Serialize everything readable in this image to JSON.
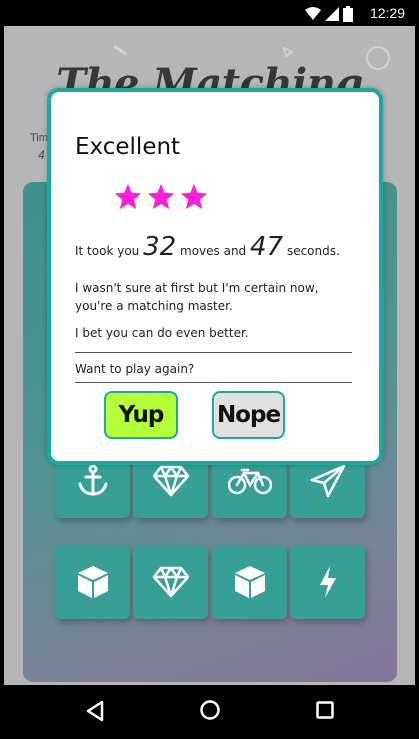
{
  "status_bar": {
    "time": "12:29",
    "icons": [
      "wifi-icon",
      "signal-icon",
      "battery-icon"
    ]
  },
  "app": {
    "title": "The Matching Game",
    "timer_label": "Tim",
    "timer_value": "4"
  },
  "deck": {
    "cards": [
      {
        "icon": "anchor-icon"
      },
      {
        "icon": "diamond-icon"
      },
      {
        "icon": "bicycle-icon"
      },
      {
        "icon": "paper-plane-icon"
      },
      {
        "icon": "cube-icon"
      },
      {
        "icon": "diamond-icon"
      },
      {
        "icon": "cube-icon"
      },
      {
        "icon": "bolt-icon"
      }
    ]
  },
  "modal": {
    "heading": "Excellent",
    "stars": 3,
    "moves_prefix": "It took you",
    "moves": "32",
    "moves_mid": "moves and",
    "seconds": "47",
    "seconds_suffix": "seconds.",
    "message1": "I wasn't sure at first but I'm certain now, you're a matching master.",
    "message2": "I bet you can do even better.",
    "prompt": "Want to play again?",
    "yes_label": "Yup",
    "no_label": "Nope"
  },
  "colors": {
    "teal_card": "#0d8a80",
    "modal_border": "#1ea8a2",
    "star": "#ff1fd6",
    "yup_bg": "#b4ff3a",
    "nope_bg": "#e0e0e0"
  },
  "nav_bar": {
    "buttons": [
      "back-icon",
      "home-icon",
      "recents-icon"
    ]
  }
}
